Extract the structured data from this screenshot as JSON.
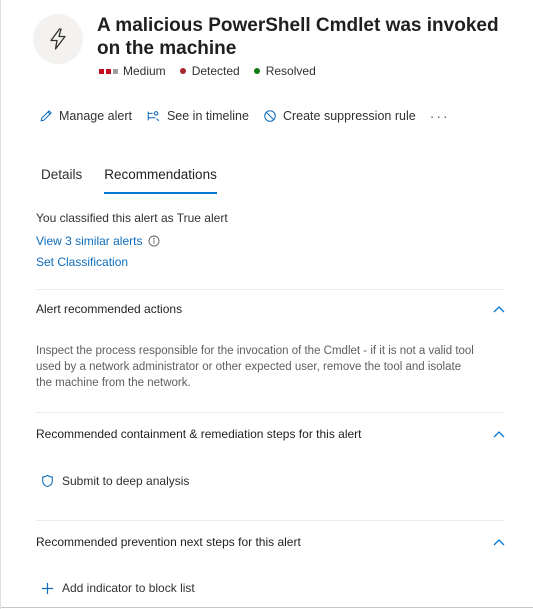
{
  "alert": {
    "title": "A malicious PowerShell Cmdlet was invoked on the machine",
    "icon": "lightning-bolt-icon",
    "severity": "Medium",
    "detection": "Detected",
    "status": "Resolved",
    "colors": {
      "severity": "#c50f1f",
      "severity_inactive": "#a19f9d",
      "detected_dot": "#a4262c",
      "resolved_dot": "#107c10",
      "accent": "#0078d4",
      "link": "#0f6cbd"
    }
  },
  "toolbar": {
    "manage_alert": "Manage alert",
    "see_in_timeline": "See in timeline",
    "create_suppression_rule": "Create suppression rule",
    "more": "···"
  },
  "tabs": [
    {
      "label": "Details",
      "active": false
    },
    {
      "label": "Recommendations",
      "active": true
    }
  ],
  "classification": {
    "text": "You classified this alert as True alert",
    "similar_link": "View 3 similar alerts",
    "set_link": "Set Classification"
  },
  "sections": {
    "recommended_actions": {
      "title": "Alert recommended actions",
      "description": "Inspect the process responsible for the invocation of the Cmdlet - if it is not a valid tool used by a network administrator or other expected user, remove the tool and isolate the machine from the network."
    },
    "containment": {
      "title": "Recommended containment & remediation steps for this alert",
      "action": "Submit to deep analysis"
    },
    "prevention": {
      "title": "Recommended prevention next steps for this alert",
      "action": "Add indicator to block list"
    }
  }
}
